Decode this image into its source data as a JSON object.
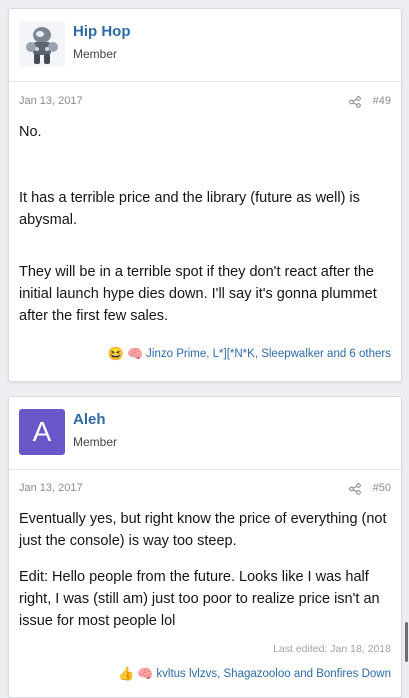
{
  "posts": [
    {
      "username": "Hip Hop",
      "user_title": "Member",
      "avatar_icon": "robot-avatar-image",
      "date": "Jan 13, 2017",
      "post_number": "#49",
      "paragraphs": [
        "No.",
        "It has a terrible price and the library (future as well) is abysmal.",
        "They will be in a terrible spot if they don't react after the initial launch hype dies down. I'll say it's gonna plummet after the first few sales."
      ],
      "reaction_icons": [
        "laughing-face-emoji",
        "brain-emoji"
      ],
      "reactions_text": "Jinzo Prime, L*][*N*K, Sleepwalker and 6 others"
    },
    {
      "username": "Aleh",
      "user_title": "Member",
      "avatar_letter": "A",
      "date": "Jan 13, 2017",
      "post_number": "#50",
      "paragraphs": [
        "Eventually yes, but right know the price of everything (not just the console) is way too steep.",
        "Edit: Hello people from the future. Looks like I was half right, I was (still am) just too poor to realize price isn't an issue for most people lol"
      ],
      "last_edited": "Last edited: Jan 18, 2018",
      "reaction_icons": [
        "thumbs-up-emoji",
        "brain-emoji"
      ],
      "reactions_text": "kvltus lvlzvs, Shagazooloo and Bonfires Down"
    }
  ],
  "colors": {
    "link": "#2f6aa3",
    "avatar_bg": "#6b56c9",
    "page_bg": "#eceef1"
  }
}
